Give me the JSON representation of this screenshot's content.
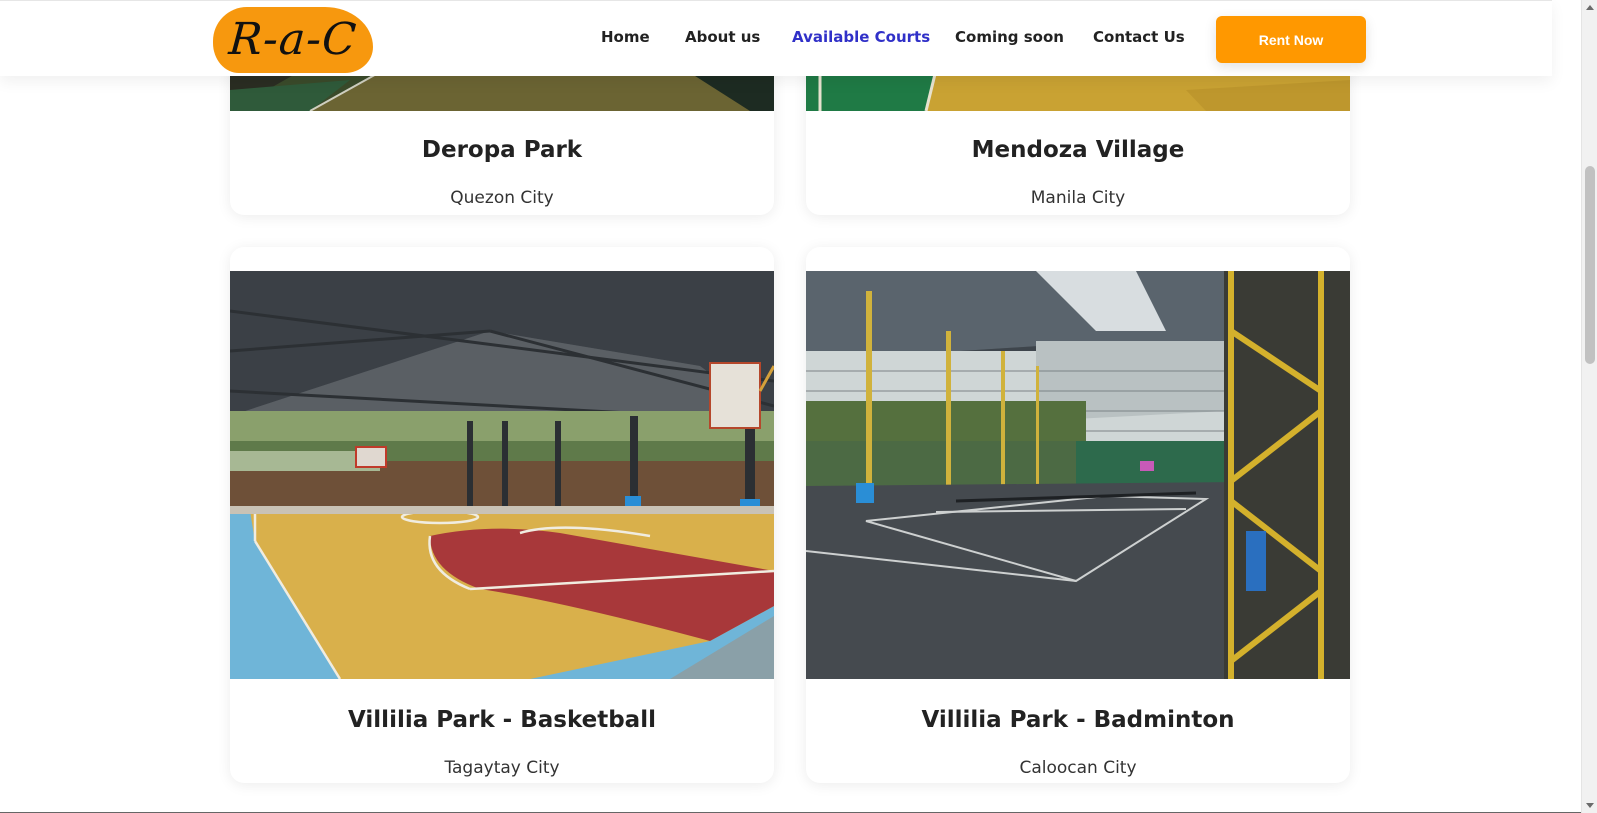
{
  "brand": {
    "logo_text": "R-a-C"
  },
  "nav": {
    "items": [
      {
        "label": "Home"
      },
      {
        "label": "About us"
      },
      {
        "label": "Available Courts"
      },
      {
        "label": "Coming soon"
      },
      {
        "label": "Contact Us"
      }
    ],
    "active": "Available Courts",
    "cta_label": "Rent Now"
  },
  "colors": {
    "accent": "#ff9800",
    "active_link": "#3030c8",
    "text": "#222222"
  },
  "courts": [
    {
      "name": "Deropa Park",
      "city": "Quezon City"
    },
    {
      "name": "Mendoza Village",
      "city": "Manila City"
    },
    {
      "name": "Villilia Park - Basketball",
      "city": "Tagaytay City"
    },
    {
      "name": "Villilia Park - Badminton",
      "city": "Caloocan City"
    }
  ]
}
